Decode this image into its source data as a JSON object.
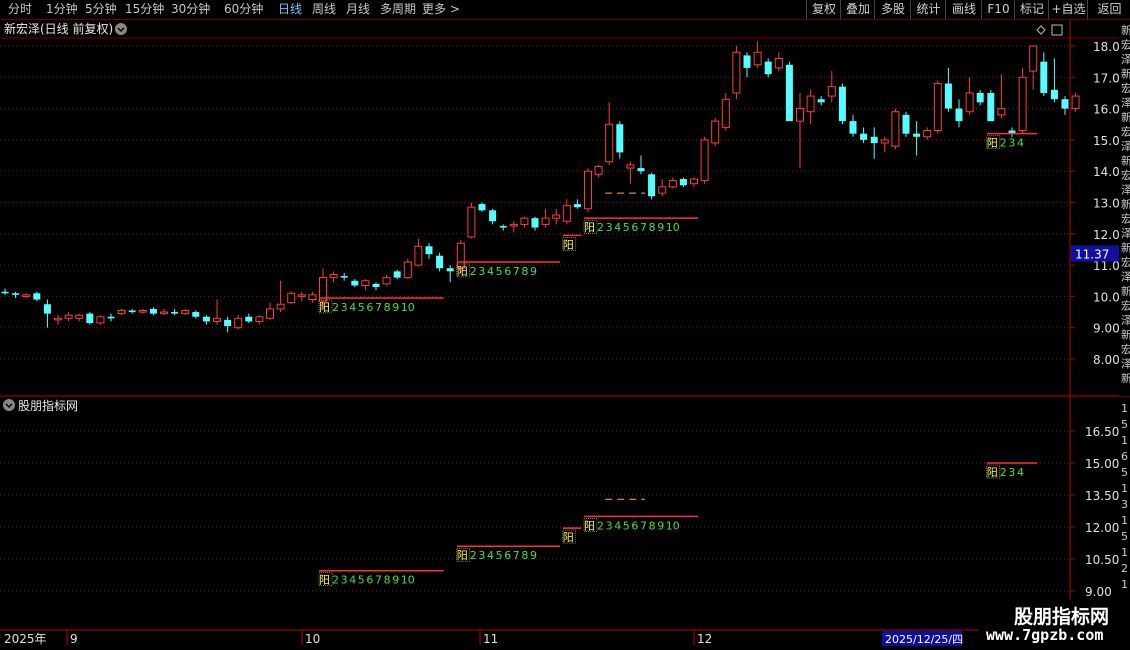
{
  "toolbar": {
    "periods": [
      "分时",
      "1分钟",
      "5分钟",
      "15分钟",
      "30分钟",
      "60分钟",
      "日线",
      "周线",
      "月线",
      "多周期",
      "更多 >"
    ],
    "active": "日线",
    "right_buttons": [
      "复权",
      "叠加",
      "多股",
      "统计",
      "画线",
      "F10",
      "标记",
      "+自选",
      "返回"
    ]
  },
  "main_panel": {
    "title": "新宏泽(日线 前复权)",
    "price_axis": [
      "18.00",
      "17.00",
      "16.00",
      "15.00",
      "14.00",
      "13.00",
      "12.00",
      "11.00",
      "10.00",
      "9.00",
      "8.00"
    ],
    "current_price": "11.37",
    "side_text": "新宏泽新宏泽新宏泽新宏泽新宏泽新宏泽新宏泽新宏泽新宏泽新宏泽新宏泽"
  },
  "indicator_panel": {
    "title": "股朋指标网",
    "axis": [
      "16.50",
      "15.00",
      "13.50",
      "12.00",
      "10.50",
      "9.00"
    ],
    "right_text": "1516513151211311"
  },
  "time_axis": {
    "year": "2025年",
    "months": [
      "9",
      "10",
      "11",
      "12"
    ],
    "cursor_date": "2025/12/25/四"
  },
  "markers": {
    "yang": "阳",
    "sequence_10": [
      "2",
      "3",
      "4",
      "5",
      "6",
      "7",
      "8",
      "9",
      "10"
    ],
    "sequence_9": [
      "2",
      "3",
      "4",
      "5",
      "6",
      "7",
      "8",
      "9"
    ],
    "sequence_4": [
      "2",
      "3",
      "4"
    ]
  },
  "logo": {
    "title": "股朋指标网",
    "url": "www.7gpzb.com"
  },
  "colors": {
    "up": "#ff3b3b",
    "down": "#54ffff",
    "grid": "#8a1010",
    "yellow": "#ffff40",
    "green": "#40e040",
    "axis_bg": "#1010a0"
  },
  "chart_data": {
    "type": "candlestick",
    "title": "新宏泽(日线 前复权)",
    "yrange": [
      7.3,
      18.4
    ],
    "candles": [
      {
        "o": 10.15,
        "h": 10.25,
        "l": 10.05,
        "c": 10.1
      },
      {
        "o": 10.1,
        "h": 10.15,
        "l": 9.95,
        "c": 10.05
      },
      {
        "o": 10.0,
        "h": 10.1,
        "l": 9.95,
        "c": 10.05
      },
      {
        "o": 10.1,
        "h": 10.15,
        "l": 9.85,
        "c": 9.9
      },
      {
        "o": 9.75,
        "h": 9.9,
        "l": 9.0,
        "c": 9.45
      },
      {
        "o": 9.25,
        "h": 9.4,
        "l": 9.1,
        "c": 9.3
      },
      {
        "o": 9.3,
        "h": 9.5,
        "l": 9.2,
        "c": 9.4
      },
      {
        "o": 9.3,
        "h": 9.45,
        "l": 9.2,
        "c": 9.4
      },
      {
        "o": 9.45,
        "h": 9.5,
        "l": 9.1,
        "c": 9.15
      },
      {
        "o": 9.15,
        "h": 9.4,
        "l": 9.1,
        "c": 9.35
      },
      {
        "o": 9.35,
        "h": 9.45,
        "l": 9.2,
        "c": 9.3
      },
      {
        "o": 9.45,
        "h": 9.6,
        "l": 9.4,
        "c": 9.55
      },
      {
        "o": 9.55,
        "h": 9.6,
        "l": 9.45,
        "c": 9.5
      },
      {
        "o": 9.5,
        "h": 9.6,
        "l": 9.45,
        "c": 9.55
      },
      {
        "o": 9.6,
        "h": 9.65,
        "l": 9.4,
        "c": 9.45
      },
      {
        "o": 9.45,
        "h": 9.6,
        "l": 9.4,
        "c": 9.5
      },
      {
        "o": 9.5,
        "h": 9.6,
        "l": 9.4,
        "c": 9.45
      },
      {
        "o": 9.45,
        "h": 9.6,
        "l": 9.4,
        "c": 9.55
      },
      {
        "o": 9.5,
        "h": 9.55,
        "l": 9.3,
        "c": 9.35
      },
      {
        "o": 9.35,
        "h": 9.4,
        "l": 9.1,
        "c": 9.2
      },
      {
        "o": 9.2,
        "h": 9.9,
        "l": 9.1,
        "c": 9.3
      },
      {
        "o": 9.25,
        "h": 9.35,
        "l": 8.85,
        "c": 9.05
      },
      {
        "o": 9.0,
        "h": 9.4,
        "l": 8.95,
        "c": 9.3
      },
      {
        "o": 9.35,
        "h": 9.45,
        "l": 9.15,
        "c": 9.2
      },
      {
        "o": 9.2,
        "h": 9.4,
        "l": 9.1,
        "c": 9.35
      },
      {
        "o": 9.3,
        "h": 9.8,
        "l": 9.25,
        "c": 9.6
      },
      {
        "o": 9.6,
        "h": 10.5,
        "l": 9.5,
        "c": 9.75
      },
      {
        "o": 9.8,
        "h": 10.15,
        "l": 9.75,
        "c": 10.1
      },
      {
        "o": 10.0,
        "h": 10.15,
        "l": 9.85,
        "c": 10.05
      },
      {
        "o": 9.9,
        "h": 10.15,
        "l": 9.8,
        "c": 10.05
      },
      {
        "o": 9.85,
        "h": 10.9,
        "l": 9.6,
        "c": 10.6
      },
      {
        "o": 10.6,
        "h": 10.8,
        "l": 10.45,
        "c": 10.7
      },
      {
        "o": 10.65,
        "h": 10.75,
        "l": 10.5,
        "c": 10.6
      },
      {
        "o": 10.5,
        "h": 10.55,
        "l": 10.3,
        "c": 10.35
      },
      {
        "o": 10.35,
        "h": 10.55,
        "l": 10.2,
        "c": 10.5
      },
      {
        "o": 10.4,
        "h": 10.45,
        "l": 10.2,
        "c": 10.3
      },
      {
        "o": 10.4,
        "h": 10.7,
        "l": 10.35,
        "c": 10.6
      },
      {
        "o": 10.8,
        "h": 10.85,
        "l": 10.55,
        "c": 10.6
      },
      {
        "o": 10.6,
        "h": 11.2,
        "l": 10.55,
        "c": 11.1
      },
      {
        "o": 11.0,
        "h": 11.85,
        "l": 10.95,
        "c": 11.6
      },
      {
        "o": 11.6,
        "h": 11.7,
        "l": 11.2,
        "c": 11.35
      },
      {
        "o": 11.3,
        "h": 11.4,
        "l": 10.8,
        "c": 10.9
      },
      {
        "o": 10.9,
        "h": 11.0,
        "l": 10.45,
        "c": 10.8
      },
      {
        "o": 10.9,
        "h": 11.8,
        "l": 10.8,
        "c": 11.7
      },
      {
        "o": 11.9,
        "h": 13.0,
        "l": 11.85,
        "c": 12.85
      },
      {
        "o": 12.95,
        "h": 13.0,
        "l": 12.7,
        "c": 12.75
      },
      {
        "o": 12.75,
        "h": 12.8,
        "l": 12.3,
        "c": 12.4
      },
      {
        "o": 12.25,
        "h": 12.3,
        "l": 12.1,
        "c": 12.2
      },
      {
        "o": 12.25,
        "h": 12.4,
        "l": 12.05,
        "c": 12.3
      },
      {
        "o": 12.3,
        "h": 12.55,
        "l": 12.2,
        "c": 12.5
      },
      {
        "o": 12.5,
        "h": 12.55,
        "l": 12.1,
        "c": 12.2
      },
      {
        "o": 12.3,
        "h": 12.8,
        "l": 12.2,
        "c": 12.5
      },
      {
        "o": 12.5,
        "h": 12.8,
        "l": 12.3,
        "c": 12.6
      },
      {
        "o": 12.4,
        "h": 13.1,
        "l": 12.3,
        "c": 12.9
      },
      {
        "o": 12.95,
        "h": 13.1,
        "l": 12.8,
        "c": 12.85
      },
      {
        "o": 12.8,
        "h": 14.1,
        "l": 12.7,
        "c": 14.0
      },
      {
        "o": 13.9,
        "h": 14.2,
        "l": 13.8,
        "c": 14.15
      },
      {
        "o": 14.3,
        "h": 16.2,
        "l": 14.2,
        "c": 15.5
      },
      {
        "o": 15.5,
        "h": 15.6,
        "l": 14.4,
        "c": 14.6
      },
      {
        "o": 14.1,
        "h": 14.3,
        "l": 13.6,
        "c": 14.2
      },
      {
        "o": 14.1,
        "h": 14.5,
        "l": 13.9,
        "c": 14.0
      },
      {
        "o": 13.9,
        "h": 13.95,
        "l": 13.1,
        "c": 13.2
      },
      {
        "o": 13.3,
        "h": 13.75,
        "l": 13.2,
        "c": 13.5
      },
      {
        "o": 13.5,
        "h": 13.8,
        "l": 13.45,
        "c": 13.7
      },
      {
        "o": 13.75,
        "h": 13.8,
        "l": 13.5,
        "c": 13.55
      },
      {
        "o": 13.6,
        "h": 13.8,
        "l": 13.5,
        "c": 13.75
      },
      {
        "o": 13.7,
        "h": 15.1,
        "l": 13.6,
        "c": 15.0
      },
      {
        "o": 14.9,
        "h": 15.7,
        "l": 14.8,
        "c": 15.6
      },
      {
        "o": 15.4,
        "h": 16.5,
        "l": 15.3,
        "c": 16.3
      },
      {
        "o": 16.5,
        "h": 18.0,
        "l": 16.3,
        "c": 17.8
      },
      {
        "o": 17.7,
        "h": 17.8,
        "l": 17.0,
        "c": 17.3
      },
      {
        "o": 17.4,
        "h": 18.15,
        "l": 17.3,
        "c": 17.8
      },
      {
        "o": 17.5,
        "h": 17.6,
        "l": 17.0,
        "c": 17.1
      },
      {
        "o": 17.3,
        "h": 17.8,
        "l": 17.2,
        "c": 17.6
      },
      {
        "o": 17.4,
        "h": 17.5,
        "l": 16.3,
        "c": 15.6
      },
      {
        "o": 15.6,
        "h": 16.5,
        "l": 14.1,
        "c": 16.0
      },
      {
        "o": 15.9,
        "h": 16.6,
        "l": 15.5,
        "c": 16.4
      },
      {
        "o": 16.3,
        "h": 16.4,
        "l": 16.1,
        "c": 16.2
      },
      {
        "o": 16.4,
        "h": 17.2,
        "l": 16.2,
        "c": 16.7
      },
      {
        "o": 16.7,
        "h": 16.8,
        "l": 15.5,
        "c": 15.6
      },
      {
        "o": 15.6,
        "h": 15.8,
        "l": 15.1,
        "c": 15.2
      },
      {
        "o": 15.2,
        "h": 15.4,
        "l": 14.9,
        "c": 15.0
      },
      {
        "o": 15.1,
        "h": 15.4,
        "l": 14.4,
        "c": 14.9
      },
      {
        "o": 14.9,
        "h": 15.1,
        "l": 14.6,
        "c": 15.0
      },
      {
        "o": 14.8,
        "h": 16.0,
        "l": 14.7,
        "c": 15.9
      },
      {
        "o": 15.8,
        "h": 15.9,
        "l": 15.1,
        "c": 15.2
      },
      {
        "o": 15.2,
        "h": 15.6,
        "l": 14.5,
        "c": 15.1
      },
      {
        "o": 15.1,
        "h": 15.4,
        "l": 15.0,
        "c": 15.3
      },
      {
        "o": 15.3,
        "h": 16.9,
        "l": 15.2,
        "c": 16.8
      },
      {
        "o": 16.8,
        "h": 17.3,
        "l": 15.9,
        "c": 16.0
      },
      {
        "o": 16.0,
        "h": 16.3,
        "l": 15.4,
        "c": 15.6
      },
      {
        "o": 15.9,
        "h": 17.0,
        "l": 15.8,
        "c": 16.5
      },
      {
        "o": 16.5,
        "h": 16.6,
        "l": 16.1,
        "c": 16.2
      },
      {
        "o": 16.5,
        "h": 16.6,
        "l": 15.6,
        "c": 15.6
      },
      {
        "o": 15.8,
        "h": 17.1,
        "l": 15.7,
        "c": 16.0
      },
      {
        "o": 15.3,
        "h": 15.4,
        "l": 15.1,
        "c": 15.2
      },
      {
        "o": 15.3,
        "h": 17.3,
        "l": 15.2,
        "c": 17.0
      },
      {
        "o": 17.2,
        "h": 18.0,
        "l": 16.6,
        "c": 18.0
      },
      {
        "o": 17.5,
        "h": 17.8,
        "l": 16.4,
        "c": 16.5
      },
      {
        "o": 16.6,
        "h": 17.6,
        "l": 16.2,
        "c": 16.3
      },
      {
        "o": 16.3,
        "h": 16.4,
        "l": 15.8,
        "c": 16.0
      },
      {
        "o": 16.0,
        "h": 16.5,
        "l": 15.9,
        "c": 16.4
      }
    ],
    "signal_lines": [
      {
        "price": 9.95,
        "start": 30,
        "end": 41,
        "labels": "sequence_10"
      },
      {
        "price": 11.1,
        "start": 43,
        "end": 52,
        "labels": "sequence_9"
      },
      {
        "price": 11.95,
        "start": 53,
        "end": 54,
        "labels": "none"
      },
      {
        "price": 12.5,
        "start": 55,
        "end": 65,
        "labels": "sequence_10"
      },
      {
        "price": 13.3,
        "start": 57,
        "end": 60,
        "dashed": true,
        "labels": "none"
      },
      {
        "price": 15.2,
        "start": 93,
        "end": 97,
        "labels": "sequence_4"
      }
    ],
    "ind_yrange": [
      8.6,
      17.2
    ],
    "ind_signals": [
      {
        "price": 9.95,
        "start": 30,
        "end": 41,
        "labels": "sequence_10"
      },
      {
        "price": 11.1,
        "start": 43,
        "end": 52,
        "labels": "sequence_9"
      },
      {
        "price": 11.95,
        "start": 53,
        "end": 54,
        "labels": "none"
      },
      {
        "price": 12.5,
        "start": 55,
        "end": 65,
        "labels": "sequence_10"
      },
      {
        "price": 13.3,
        "start": 57,
        "end": 60,
        "dashed": true,
        "labels": "none"
      },
      {
        "price": 15.0,
        "start": 93,
        "end": 97,
        "labels": "sequence_4"
      }
    ]
  }
}
